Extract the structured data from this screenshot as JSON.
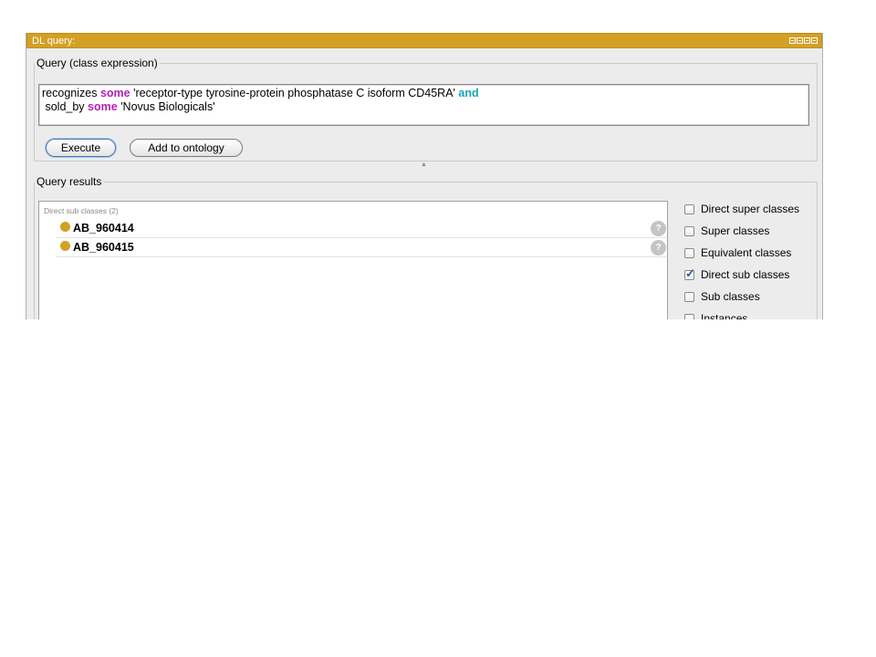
{
  "window": {
    "title": "DL query:"
  },
  "query_panel": {
    "legend": "Query (class expression)",
    "expression": {
      "line1_part1": "recognizes ",
      "line1_kw1": "some",
      "line1_part2": " 'receptor-type tyrosine-protein phosphatase C isoform CD45RA' ",
      "line1_kw2": "and",
      "line2_part1": " sold_by ",
      "line2_kw1": "some",
      "line2_part2": " 'Novus Biologicals'"
    },
    "execute_label": "Execute",
    "add_label": "Add to ontology"
  },
  "results_panel": {
    "legend": "Query results",
    "section_label": "Direct sub classes (2)",
    "items": [
      {
        "name": "AB_960414",
        "help": "?"
      },
      {
        "name": "AB_960415",
        "help": "?"
      }
    ],
    "options": [
      {
        "label": "Direct super classes",
        "checked": false
      },
      {
        "label": "Super classes",
        "checked": false
      },
      {
        "label": "Equivalent classes",
        "checked": false
      },
      {
        "label": "Direct sub classes",
        "checked": true
      },
      {
        "label": "Sub classes",
        "checked": false
      },
      {
        "label": "Instances",
        "checked": false
      }
    ]
  },
  "colors": {
    "titlebar": "#d3a024",
    "keyword_some": "#b520b5",
    "keyword_and": "#1aa6b5",
    "class_dot": "#d3a024"
  }
}
